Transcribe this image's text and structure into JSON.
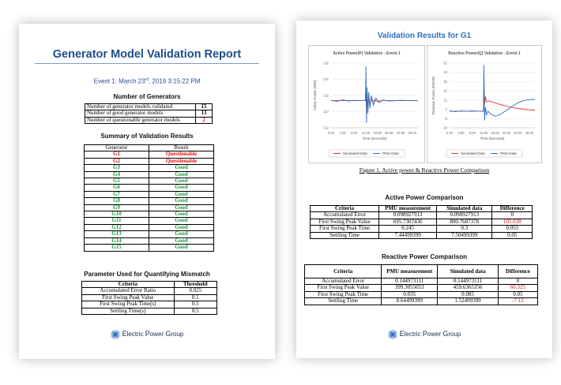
{
  "page1": {
    "title": "Generator Model Validation Report",
    "event": "Event 1: March 23",
    "event_sup": "rd",
    "event_rest": ", 2019 3:15:22 PM",
    "num_gen_heading": "Number of Generators",
    "num_gen_rows": [
      {
        "label": "Number of generator models validated",
        "value": "15"
      },
      {
        "label": "Number of good generator models",
        "value": "13"
      },
      {
        "label": "Number of questionable generator models",
        "value": "2"
      }
    ],
    "summary_heading": "Summary of Validation Results",
    "summary_cols": [
      "Generator",
      "Result"
    ],
    "summary_rows": [
      {
        "gen": "G1",
        "result": "Questionable"
      },
      {
        "gen": "G2",
        "result": "Questionable"
      },
      {
        "gen": "G3",
        "result": "Good"
      },
      {
        "gen": "G4",
        "result": "Good"
      },
      {
        "gen": "G5",
        "result": "Good"
      },
      {
        "gen": "G6",
        "result": "Good"
      },
      {
        "gen": "G7",
        "result": "Good"
      },
      {
        "gen": "G8",
        "result": "Good"
      },
      {
        "gen": "G9",
        "result": "Good"
      },
      {
        "gen": "G10",
        "result": "Good"
      },
      {
        "gen": "G11",
        "result": "Good"
      },
      {
        "gen": "G12",
        "result": "Good"
      },
      {
        "gen": "G13",
        "result": "Good"
      },
      {
        "gen": "G14",
        "result": "Good"
      },
      {
        "gen": "G15",
        "result": "Good"
      }
    ],
    "param_heading": "Parameter Used for Quantifying Mismatch",
    "param_cols": [
      "Criteria",
      "Threshold"
    ],
    "param_rows": [
      {
        "criteria": "Accumulated Error Ratio",
        "threshold": "0.025"
      },
      {
        "criteria": "First Swing Peak Value",
        "threshold": "0.1"
      },
      {
        "criteria": "First Swing Peak Time(s)",
        "threshold": "0.5"
      },
      {
        "criteria": "Settling Time(s)",
        "threshold": "0.5"
      }
    ],
    "logo": {
      "w1": "E",
      "r1": "lectric ",
      "w2": "P",
      "r2": "ower ",
      "w3": "G",
      "r3": "roup"
    }
  },
  "page2": {
    "title": "Validation Results for G1",
    "figure_caption": "Figure 1. Active power & Reactive Power Comparison",
    "active_heading": "Active Power Comparison",
    "active_cols": [
      "Criteria",
      "PMU measurement",
      "Simulated data",
      "Difference"
    ],
    "active_rows": [
      {
        "criteria": "Accumulated Error",
        "pmu": "0.098927913",
        "sim": "0.098927913",
        "diff": "0"
      },
      {
        "criteria": "First Swing Peak Value",
        "pmu": "695.7307436",
        "sim": "800.7687378",
        "diff": "105.038"
      },
      {
        "criteria": "First Swing Peak Time",
        "pmu": "0.245",
        "sim": "0.3",
        "diff": "0.055"
      },
      {
        "criteria": "Settling Time",
        "pmu": "7.44499399",
        "sim": "7.50499399",
        "diff": "0.05"
      }
    ],
    "reactive_heading": "Reactive Power Comparison",
    "reactive_cols": [
      "Criteria",
      "PMU measurement",
      "Simulated data",
      "Difference"
    ],
    "reactive_rows": [
      {
        "criteria": "Accumulated Error",
        "pmu": "0.144973111",
        "sim": "0.144973111",
        "diff": "0"
      },
      {
        "criteria": "First Swing Peak Value",
        "pmu": "399.3055053",
        "sim": "459.6365356",
        "diff": "60.325"
      },
      {
        "criteria": "First Swing Peak Time",
        "pmu": "0.035",
        "sim": "0.085",
        "diff": "0.05"
      },
      {
        "criteria": "Settling Time",
        "pmu": "8.64499399",
        "sim": "1.52499399",
        "diff": "-7.12"
      }
    ],
    "logo": {
      "w1": "E",
      "r1": "lectric ",
      "w2": "P",
      "r2": "ower ",
      "w3": "G",
      "r3": "roup"
    }
  },
  "chart_data": [
    {
      "type": "line",
      "title": "Active Power(P) Validation - Event 1",
      "xlabel": "Time (seconds)",
      "ylabel": "Active Power (MW)",
      "x_ticks": [
        "0.00",
        "4.00",
        "8.00",
        "12.00",
        "16.00",
        "20.00",
        "24.00",
        "28.00"
      ],
      "y_ticks": [
        "132",
        "127",
        "122",
        "117",
        "112"
      ],
      "xlim": [
        0,
        30
      ],
      "ylim": [
        112,
        132
      ],
      "legend": "bottom",
      "series": [
        {
          "name": "Simulated Data",
          "color": "#e03030",
          "x": [
            0,
            10,
            11.8,
            12.0,
            12.2,
            12.4,
            12.7,
            13.0,
            13.4,
            13.8,
            14.4,
            15,
            16,
            18,
            20,
            24,
            28,
            30
          ],
          "y": [
            120.4,
            120.4,
            120.4,
            124.0,
            116.5,
            121.5,
            118.0,
            121.8,
            119.0,
            121.0,
            119.8,
            120.6,
            120.2,
            120.5,
            120.4,
            120.4,
            120.4,
            120.4
          ]
        },
        {
          "name": "PMU Data",
          "color": "#2f6fbf",
          "x": [
            0,
            2,
            4,
            6,
            8,
            10,
            11.9,
            12.05,
            12.25,
            12.45,
            12.7,
            13.0,
            13.4,
            13.9,
            14.6,
            15.5,
            16.5,
            18,
            20,
            24,
            28,
            30
          ],
          "y": [
            120.5,
            120.2,
            120.6,
            120.3,
            120.5,
            120.4,
            120.4,
            131.0,
            113.5,
            124.5,
            116.5,
            123.0,
            118.0,
            122.0,
            119.0,
            121.2,
            119.8,
            120.6,
            120.3,
            120.5,
            120.4,
            120.4
          ]
        }
      ]
    },
    {
      "type": "line",
      "title": "Reactive Power(Q) Validation - Event 1",
      "xlabel": "Time (seconds)",
      "ylabel": "Reactive Power (MVAR)",
      "x_ticks": [
        "0.00",
        "4.00",
        "8.00",
        "12.00",
        "16.00",
        "20.00",
        "24.00",
        "28.00"
      ],
      "y_ticks": [
        "52",
        "42",
        "32",
        "22",
        "12",
        "2",
        "-8",
        "-18"
      ],
      "xlim": [
        0,
        30
      ],
      "ylim": [
        -18,
        52
      ],
      "legend": "bottom",
      "series": [
        {
          "name": "Simulated Data",
          "color": "#e03030",
          "x": [
            0,
            10,
            11.9,
            12.1,
            12.3,
            12.6,
            13.0,
            14,
            16,
            18,
            20,
            22,
            24,
            26,
            28,
            30
          ],
          "y": [
            0,
            0,
            0,
            24,
            8,
            16,
            10,
            11,
            9,
            7,
            5.5,
            4,
            3,
            2.2,
            1.5,
            1.2
          ]
        },
        {
          "name": "PMU Data",
          "color": "#2f6fbf",
          "x": [
            0,
            2,
            4,
            6,
            8,
            10,
            11.9,
            12.05,
            12.3,
            12.6,
            13.0,
            13.5,
            14.5,
            16,
            17.5,
            19,
            20.5,
            22,
            24,
            26,
            28,
            30
          ],
          "y": [
            0.5,
            -0.5,
            0.3,
            -0.2,
            0.4,
            0,
            0,
            50,
            -10,
            4,
            -4,
            0,
            -3,
            -5.5,
            -4,
            -1,
            2,
            5.5,
            9,
            11.5,
            12.5,
            12.8
          ]
        }
      ]
    }
  ]
}
